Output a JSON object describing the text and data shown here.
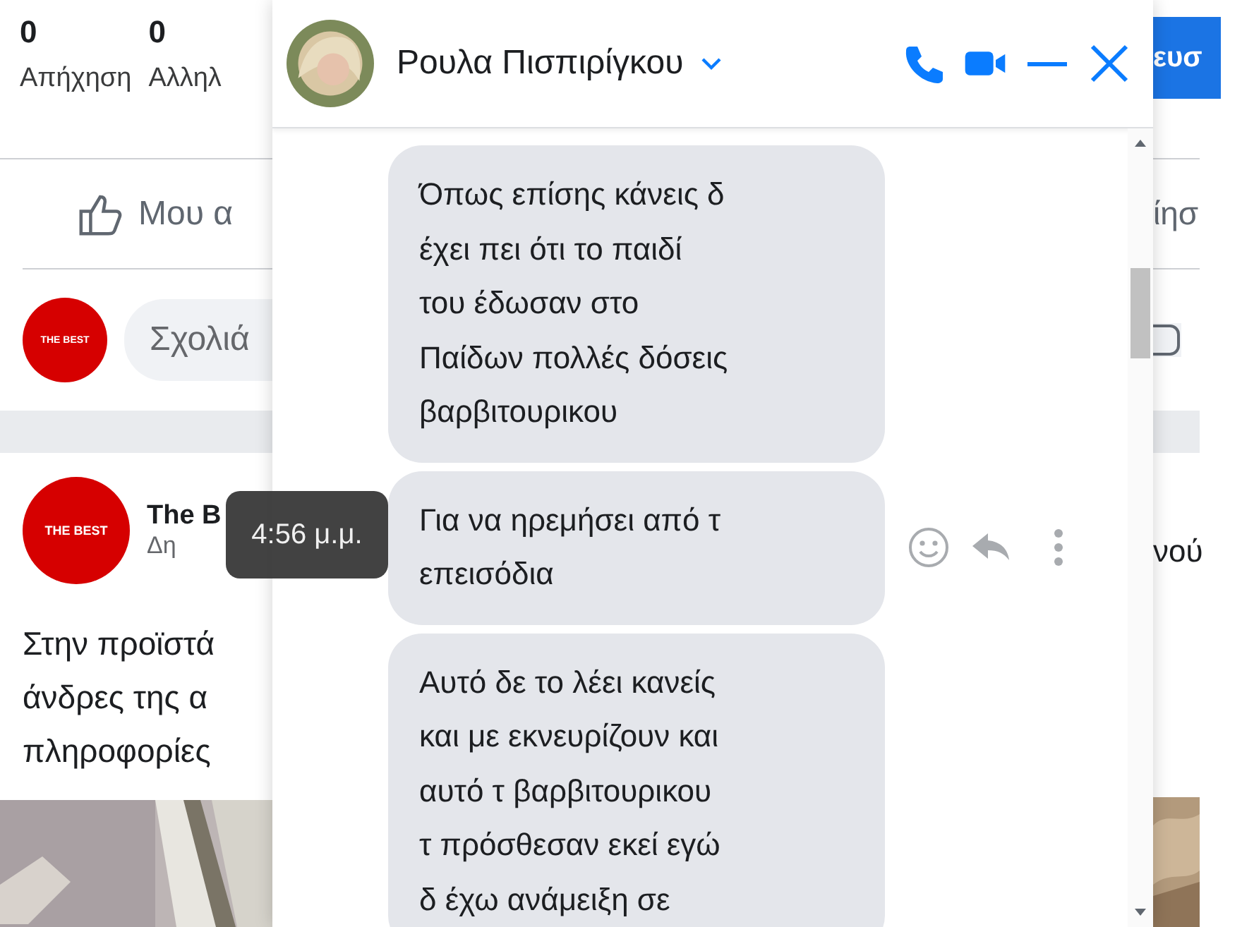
{
  "feed": {
    "stats": [
      {
        "count": "0",
        "label": "Απήχηση"
      },
      {
        "count": "0",
        "label": "Αλληλ"
      }
    ],
    "promote_button": "ευσ",
    "like_button": "Μου α",
    "share_button": "ίησ",
    "comment": {
      "avatar": "THE BEST",
      "placeholder": "Σχολιά"
    },
    "post": {
      "avatar": "THE BEST",
      "author": "The B",
      "meta": "Δη",
      "text_left": [
        "Στην προϊστά",
        "άνδρες της α",
        "πληροφορίες"
      ],
      "text_right": "νού"
    }
  },
  "chat": {
    "contact": "Ρουλα Πισπιρίγκου",
    "messages": [
      {
        "text": "Όπως επίσης κάνεις δ\nέχει πει ότι το παιδί\nτου έδωσαν στο\nΠαίδων πολλές δόσεις\nβαρβιτουρικου",
        "hovered": false
      },
      {
        "text": "Για να ηρεμήσει από τ\nεπεισόδια",
        "hovered": true
      },
      {
        "text": "Αυτό δε το λέει κανείς\nκαι με εκνευρίζουν και\nαυτό τ βαρβιτουρικου\nτ πρόσθεσαν εκεί εγώ\nδ έχω ανάμειξη σε",
        "hovered": false
      }
    ],
    "tooltip": "4:56 μ.μ."
  }
}
